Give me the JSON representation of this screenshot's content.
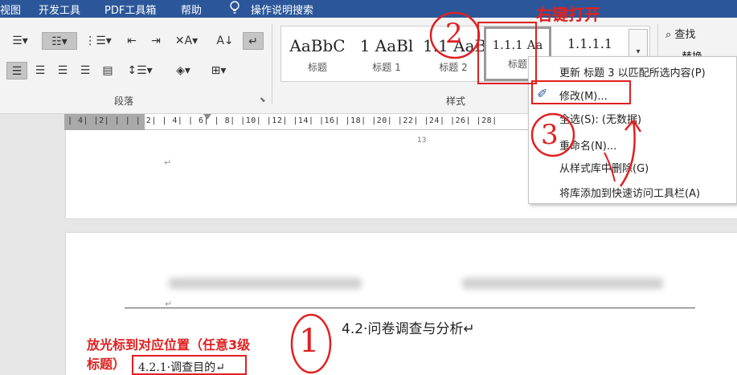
{
  "menubar": {
    "items": [
      "视图",
      "开发工具",
      "PDF工具箱",
      "帮助",
      "操作说明搜索"
    ]
  },
  "ribbon": {
    "paragraph_group_label": "段落",
    "styles_group_label": "样式",
    "styles": [
      {
        "preview": "AaBbC",
        "name": "标题"
      },
      {
        "preview": "1 AaBl",
        "name": "标题 1"
      },
      {
        "preview": "1.1 AaB",
        "name": "标题 2"
      },
      {
        "preview": "1.1.1 Aa",
        "name": "标题"
      },
      {
        "preview": "1.1.1.1",
        "name": ""
      }
    ],
    "find_label": "查找",
    "replace_label": "替换"
  },
  "ruler": {
    "numbers": "| 4| |2|  |  |  | 2|  | 4|  | 6|  | 8|  |10|  |12|  |14|  |16|  |18|  |20|  |22|  |24|  |26|  |28|"
  },
  "document": {
    "page_number": "13",
    "paragraph_mark": "↵",
    "heading_2": "4.2·问卷调查与分析↵",
    "heading_3": "4.2.1·调查目的↵"
  },
  "context_menu": {
    "items": [
      "更新 标题 3 以匹配所选内容(P)",
      "修改(M)...",
      "全选(S): (无数据)",
      "重命名(N)...",
      "从样式库中删除(G)",
      "将库添加到快速访问工具栏(A)"
    ]
  },
  "annotations": {
    "right_click_open": "右键打开",
    "place_cursor_line1": "放光标到对应位置（任意3级",
    "place_cursor_line2": "标题）",
    "step1": "1",
    "step2": "2",
    "step3": "3"
  },
  "colors": {
    "menubar": "#2b579a",
    "annotation_red": "#e02020",
    "ribbon_bg": "#f3f3f3"
  }
}
